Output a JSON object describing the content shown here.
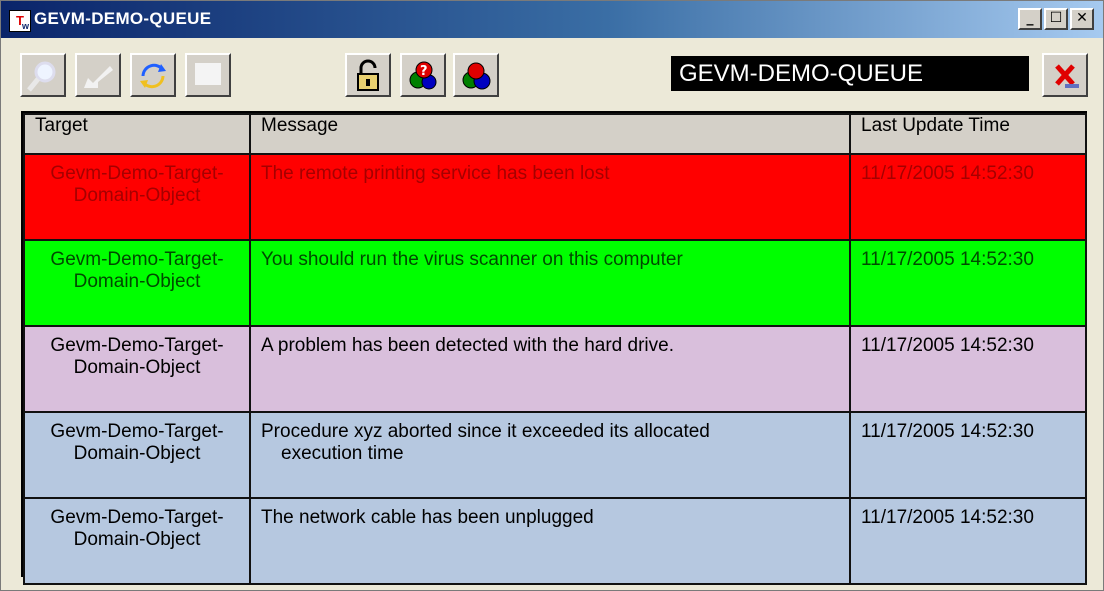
{
  "window": {
    "title": "GEVM-DEMO-QUEUE",
    "app_icon": "T",
    "app_icon_sub": "w"
  },
  "window_controls": {
    "minimize": "_",
    "maximize": "☐",
    "close": "✕"
  },
  "toolbar": {
    "buttons": [
      {
        "name": "magnifier-icon"
      },
      {
        "name": "arrow-back-icon"
      },
      {
        "name": "refresh-icon"
      },
      {
        "name": "blank-icon"
      },
      {
        "name": "lock-icon"
      },
      {
        "name": "target-help-icon"
      },
      {
        "name": "color-balls-icon"
      }
    ],
    "queue_name": "GEVM-DEMO-QUEUE",
    "close_queue_icon": "red-x-icon"
  },
  "table": {
    "headers": {
      "target": "Target",
      "message": "Message",
      "time": "Last Update Time"
    },
    "rows": [
      {
        "target": "Gevm-Demo-Target-Domain-Object",
        "message": "The remote printing service has been lost",
        "message_cont": "",
        "time": "11/17/2005 14:52:30",
        "status": "red"
      },
      {
        "target": "Gevm-Demo-Target-Domain-Object",
        "message": "You should run the virus scanner on this computer",
        "message_cont": "",
        "time": "11/17/2005 14:52:30",
        "status": "green"
      },
      {
        "target": "Gevm-Demo-Target-Domain-Object",
        "message": "A problem has been detected with the hard drive.",
        "message_cont": "",
        "time": "11/17/2005 14:52:30",
        "status": "lilac"
      },
      {
        "target": "Gevm-Demo-Target-Domain-Object",
        "message": "Procedure xyz aborted since it exceeded its allocated",
        "message_cont": "execution time",
        "time": "11/17/2005 14:52:30",
        "status": "blue"
      },
      {
        "target": "Gevm-Demo-Target-Domain-Object",
        "message": "The network cable has been unplugged",
        "message_cont": "",
        "time": "11/17/2005 14:52:30",
        "status": "blue"
      }
    ]
  },
  "colors": {
    "red": "#ff0000",
    "green": "#00ff00",
    "lilac": "#d9bfdc",
    "blue": "#b6c8e0"
  }
}
